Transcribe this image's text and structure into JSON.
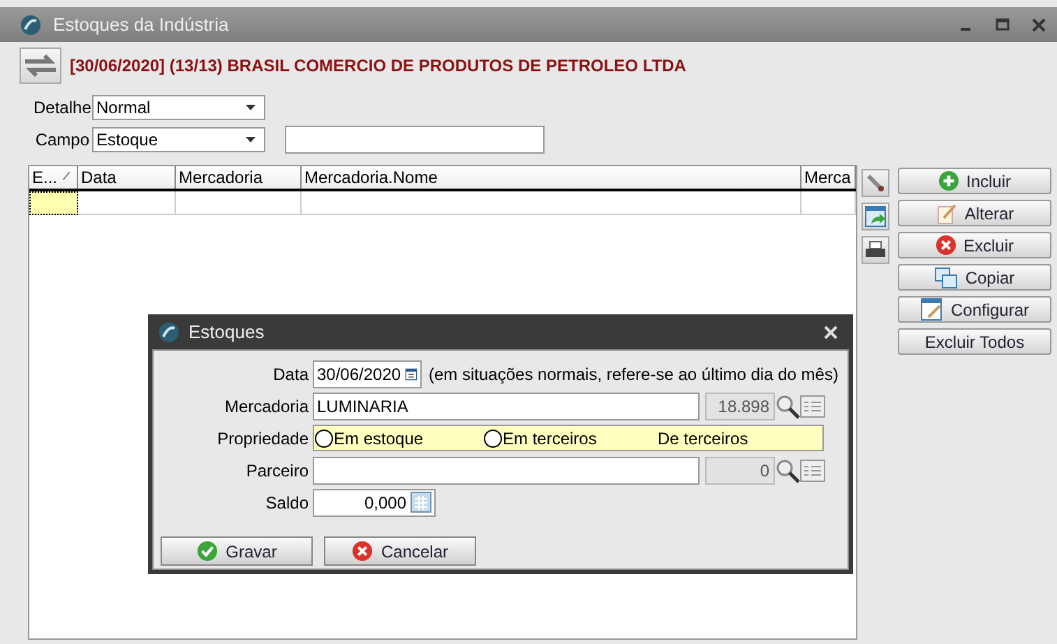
{
  "window": {
    "title": "Estoques da Indústria"
  },
  "header": {
    "title": "[30/06/2020] (13/13) BRASIL COMERCIO DE PRODUTOS DE PETROLEO LTDA"
  },
  "filters": [
    {
      "label": "Detalhe",
      "value": "Normal"
    },
    {
      "label": "Campo",
      "value": "Estoque"
    }
  ],
  "grid": {
    "columns": [
      {
        "label": "E...",
        "sorted": true
      },
      {
        "label": "Data",
        "sorted": false
      },
      {
        "label": "Mercadoria",
        "sorted": false
      },
      {
        "label": "Mercadoria.Nome",
        "sorted": false
      },
      {
        "label": "Merca",
        "sorted": false
      }
    ]
  },
  "side_buttons": [
    {
      "label": "Incluir",
      "kind": "add"
    },
    {
      "label": "Alterar",
      "kind": "edit"
    },
    {
      "label": "Excluir",
      "kind": "delete"
    },
    {
      "label": "Copiar",
      "kind": "copy"
    },
    {
      "label": "Configurar",
      "kind": "config"
    },
    {
      "label": "Excluir Todos",
      "kind": "plain"
    }
  ],
  "dialog": {
    "title": "Estoques",
    "date": {
      "label": "Data",
      "value": "30/06/2020",
      "hint": "(em situações normais, refere-se ao último dia do mês)"
    },
    "mercadoria": {
      "label": "Mercadoria",
      "value": "LUMINARIA",
      "code": "18.898"
    },
    "propriedade": {
      "label": "Propriedade",
      "options": [
        {
          "label": "Em estoque",
          "kind": "radio",
          "selected": false
        },
        {
          "label": "Em terceiros",
          "kind": "radio",
          "selected": false
        },
        {
          "label": "De terceiros",
          "kind": "text",
          "selected": false
        }
      ]
    },
    "parceiro": {
      "label": "Parceiro",
      "code": "0"
    },
    "saldo": {
      "label": "Saldo",
      "value": "0,000"
    },
    "buttons": [
      {
        "label": "Gravar",
        "kind": "ok"
      },
      {
        "label": "Cancelar",
        "kind": "cancel"
      }
    ]
  }
}
